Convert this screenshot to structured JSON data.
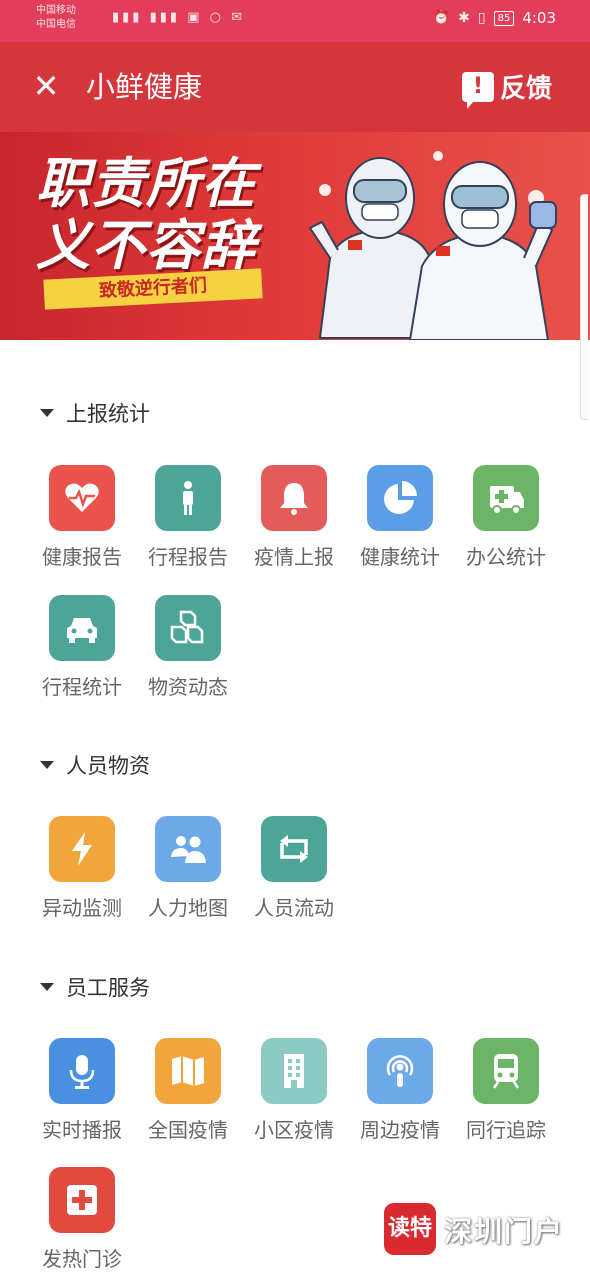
{
  "status_bar": {
    "carrier1": "中国移动",
    "carrier2": "中国电信",
    "battery": "85",
    "time": "4:03"
  },
  "title_bar": {
    "close_icon": "close-icon",
    "title": "小鲜健康",
    "feedback_label": "反馈"
  },
  "banner": {
    "line1": "职责所在",
    "line2": "义不容辞",
    "ribbon": "致敬逆行者们"
  },
  "sections": [
    {
      "title": "上报统计",
      "items": [
        {
          "label": "健康报告",
          "icon": "heartbeat-icon",
          "color": "#e9534b"
        },
        {
          "label": "行程报告",
          "icon": "person-icon",
          "color": "#4ca596"
        },
        {
          "label": "疫情上报",
          "icon": "bell-icon",
          "color": "#e45c5a"
        },
        {
          "label": "健康统计",
          "icon": "pie-chart-icon",
          "color": "#5b9ee8"
        },
        {
          "label": "办公统计",
          "icon": "ambulance-icon",
          "color": "#6cb466"
        },
        {
          "label": "行程统计",
          "icon": "car-icon",
          "color": "#4ca596"
        },
        {
          "label": "物资动态",
          "icon": "boxes-icon",
          "color": "#4ca596"
        }
      ]
    },
    {
      "title": "人员物资",
      "items": [
        {
          "label": "异动监测",
          "icon": "lightning-icon",
          "color": "#f1a63c"
        },
        {
          "label": "人力地图",
          "icon": "people-icon",
          "color": "#6da8e8"
        },
        {
          "label": "人员流动",
          "icon": "repeat-icon",
          "color": "#4ca596"
        }
      ]
    },
    {
      "title": "员工服务",
      "items": [
        {
          "label": "实时播报",
          "icon": "microphone-icon",
          "color": "#4a90e0"
        },
        {
          "label": "全国疫情",
          "icon": "map-icon",
          "color": "#f1a63c"
        },
        {
          "label": "小区疫情",
          "icon": "building-icon",
          "color": "#8ccbc4"
        },
        {
          "label": "周边疫情",
          "icon": "podcast-icon",
          "color": "#6da8e8"
        },
        {
          "label": "同行追踪",
          "icon": "train-icon",
          "color": "#6cb466"
        },
        {
          "label": "发热门诊",
          "icon": "medical-cross-icon",
          "color": "#e2493f"
        }
      ]
    }
  ],
  "watermark": {
    "badge": "读特",
    "text": "深圳门户"
  }
}
